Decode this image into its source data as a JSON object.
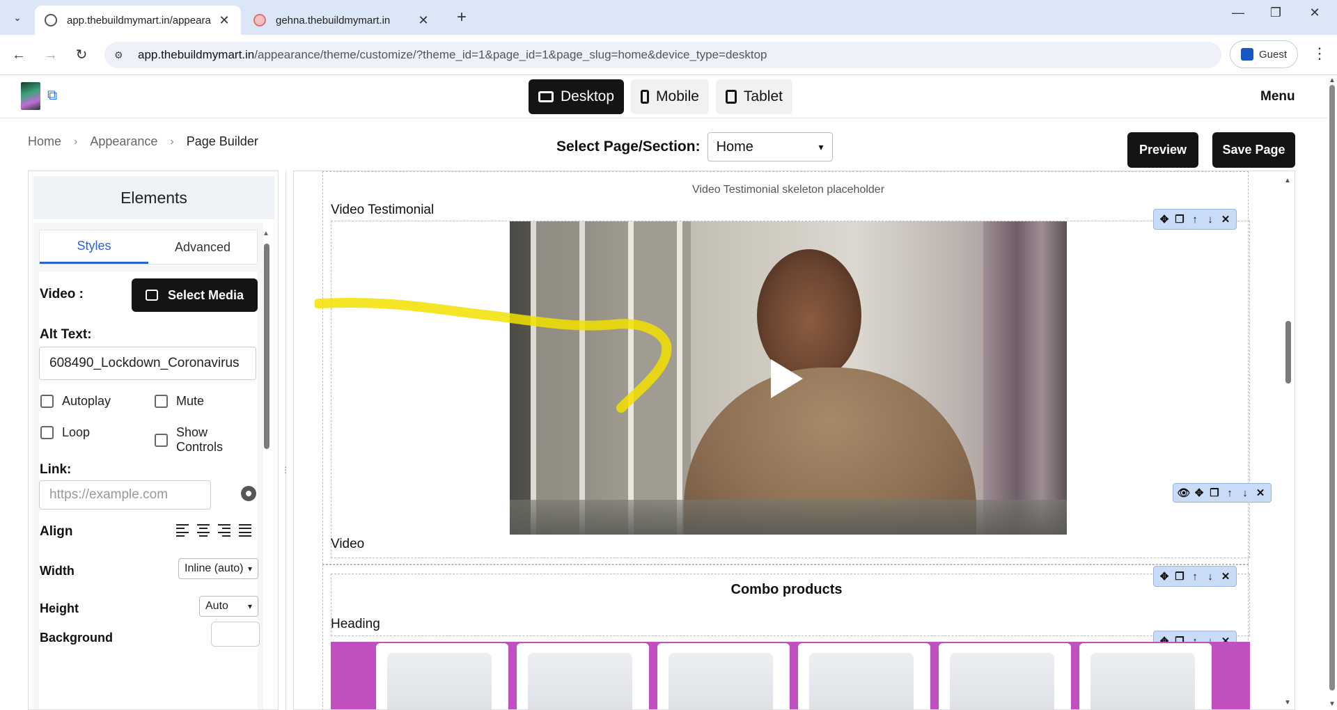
{
  "browser": {
    "tabs": [
      {
        "title": "app.thebuildmymart.in/appeara",
        "active": true
      },
      {
        "title": "gehna.thebuildmymart.in",
        "active": false
      }
    ],
    "url_host": "app.thebuildmymart.in",
    "url_path": "/appearance/theme/customize/?theme_id=1&page_id=1&page_slug=home&device_type=desktop",
    "profile_label": "Guest"
  },
  "header": {
    "devices": [
      {
        "label": "Desktop",
        "active": true
      },
      {
        "label": "Mobile",
        "active": false
      },
      {
        "label": "Tablet",
        "active": false
      }
    ],
    "menu_label": "Menu"
  },
  "toolbar": {
    "breadcrumb": [
      "Home",
      "Appearance",
      "Page Builder"
    ],
    "select_label": "Select Page/Section:",
    "selected_page": "Home",
    "preview_label": "Preview",
    "save_label": "Save Page"
  },
  "panel": {
    "title": "Elements",
    "tabs": [
      {
        "label": "Styles",
        "active": true
      },
      {
        "label": "Advanced",
        "active": false
      }
    ],
    "video_label": "Video :",
    "select_media_label": "Select Media",
    "alt_text_label": "Alt Text:",
    "alt_text_value": "608490_Lockdown_Coronavirus",
    "checkboxes": {
      "autoplay": "Autoplay",
      "mute": "Mute",
      "loop": "Loop",
      "show_controls": "Show Controls"
    },
    "link_label": "Link:",
    "link_placeholder": "https://example.com",
    "align_label": "Align",
    "width_label": "Width",
    "width_value": "Inline (auto)",
    "height_label": "Height",
    "height_value": "Auto",
    "background_label": "Background"
  },
  "canvas": {
    "skeleton_note": "Video Testimonial skeleton placeholder",
    "section_label": "Video Testimonial",
    "video_label": "Video",
    "combo_title": "Combo products",
    "heading_label": "Heading",
    "product_count": 6,
    "product_band_color": "#c04fc0"
  },
  "colors": {
    "accent": "#2c5fd8",
    "dark_button": "#141414",
    "controls_bg": "#c8dcf7"
  }
}
